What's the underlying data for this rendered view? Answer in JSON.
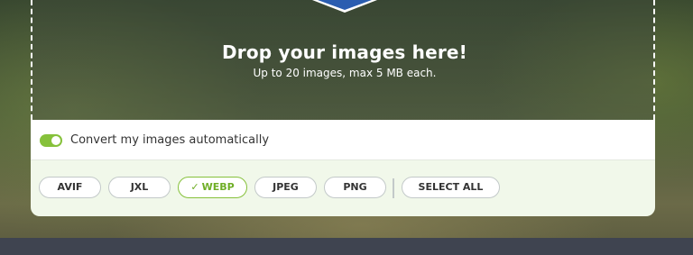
{
  "dropzone": {
    "title": "Drop your images here!",
    "subtitle": "Up to 20 images, max 5 MB each."
  },
  "toggle": {
    "label": "Convert my images automatically",
    "state": "on",
    "color": "#86c13b"
  },
  "formats": {
    "items": [
      {
        "label": "AVIF",
        "selected": false
      },
      {
        "label": "JXL",
        "selected": false
      },
      {
        "label": "WEBP",
        "selected": true
      },
      {
        "label": "JPEG",
        "selected": false
      },
      {
        "label": "PNG",
        "selected": false
      }
    ],
    "select_all_label": "SELECT ALL",
    "check_icon": "check-icon"
  },
  "colors": {
    "accent": "#86c13b",
    "formats_bg": "#f1f8ea",
    "shield_blue": "#2a5db0"
  }
}
